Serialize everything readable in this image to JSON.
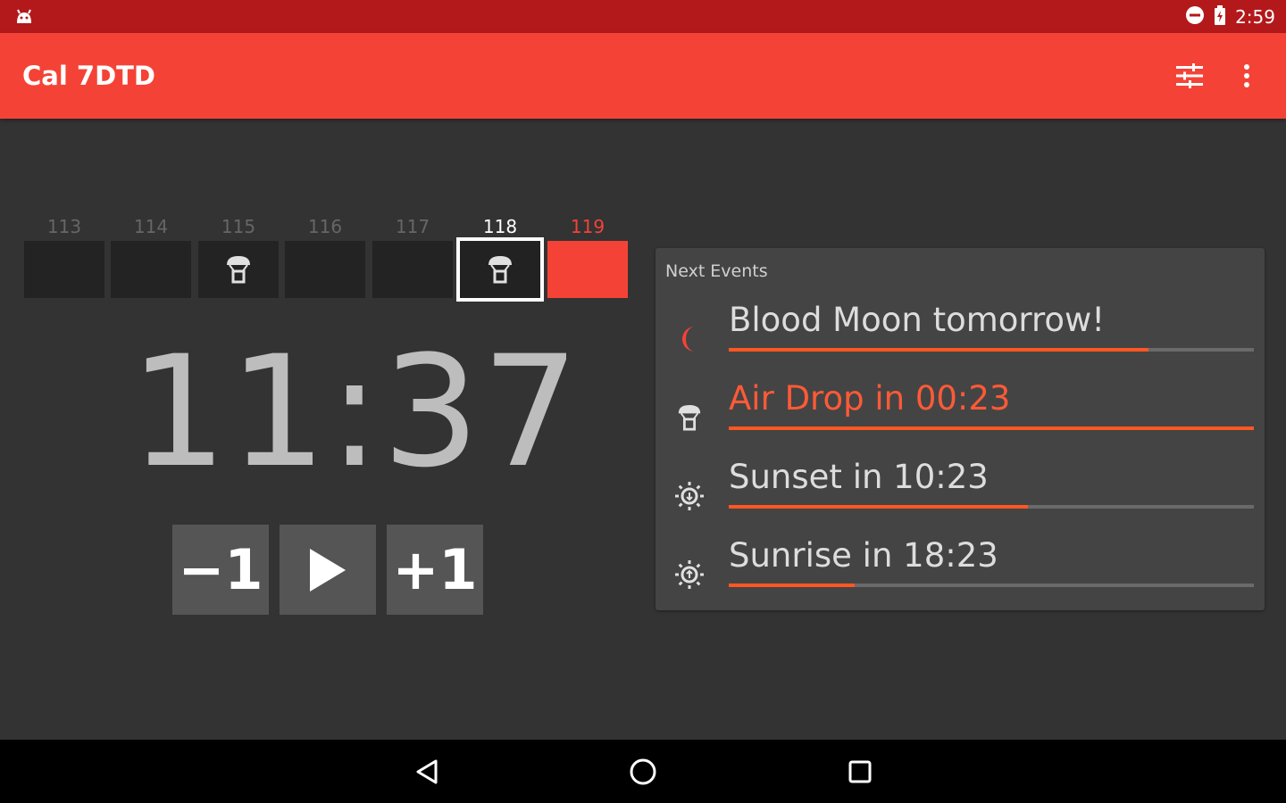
{
  "status_bar": {
    "time": "2:59"
  },
  "app_bar": {
    "title": "Cal 7DTD"
  },
  "days": [
    {
      "number": "113",
      "state": "past",
      "airdrop": false
    },
    {
      "number": "114",
      "state": "past",
      "airdrop": false
    },
    {
      "number": "115",
      "state": "past",
      "airdrop": true
    },
    {
      "number": "116",
      "state": "past",
      "airdrop": false
    },
    {
      "number": "117",
      "state": "past",
      "airdrop": false
    },
    {
      "number": "118",
      "state": "current",
      "airdrop": true
    },
    {
      "number": "119",
      "state": "blood",
      "airdrop": false
    }
  ],
  "clock": {
    "time": "11:37"
  },
  "controls": {
    "minus_label": "−1",
    "plus_label": "+1"
  },
  "events": {
    "header": "Next Events",
    "items": [
      {
        "text": "Blood Moon tomorrow!",
        "icon": "moon-icon",
        "progress": 0.8,
        "alert": false
      },
      {
        "text": "Air Drop in 00:23",
        "icon": "airdrop-icon",
        "progress": 1.0,
        "alert": true
      },
      {
        "text": "Sunset in 10:23",
        "icon": "sunset-icon",
        "progress": 0.57,
        "alert": false
      },
      {
        "text": "Sunrise in 18:23",
        "icon": "sunrise-icon",
        "progress": 0.24,
        "alert": false
      }
    ]
  },
  "colors": {
    "accent": "#f44336",
    "status_bar": "#b3191b",
    "progress": "#ff5722",
    "background": "#333333"
  }
}
